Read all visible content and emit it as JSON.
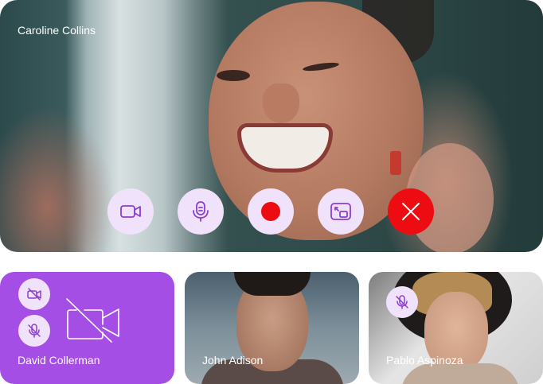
{
  "main_call": {
    "participant_name": "Caroline Collins"
  },
  "controls": [
    {
      "name": "camera",
      "icon": "video-camera-icon"
    },
    {
      "name": "microphone",
      "icon": "microphone-icon"
    },
    {
      "name": "record",
      "icon": "record-icon"
    },
    {
      "name": "screen-share",
      "icon": "screen-share-icon"
    },
    {
      "name": "end-call",
      "icon": "close-icon"
    }
  ],
  "participants": [
    {
      "name": "David Collerman",
      "camera_off": true,
      "muted": true
    },
    {
      "name": "John Adison",
      "camera_off": false,
      "muted": false
    },
    {
      "name": "Pablo Aspinoza",
      "camera_off": false,
      "muted": true
    }
  ],
  "colors": {
    "accent": "#a54ee6",
    "control_bg": "#f1e2fb",
    "end_call": "#ee0c13",
    "record": "#ee0c13",
    "icon": "#8a3fd0"
  }
}
